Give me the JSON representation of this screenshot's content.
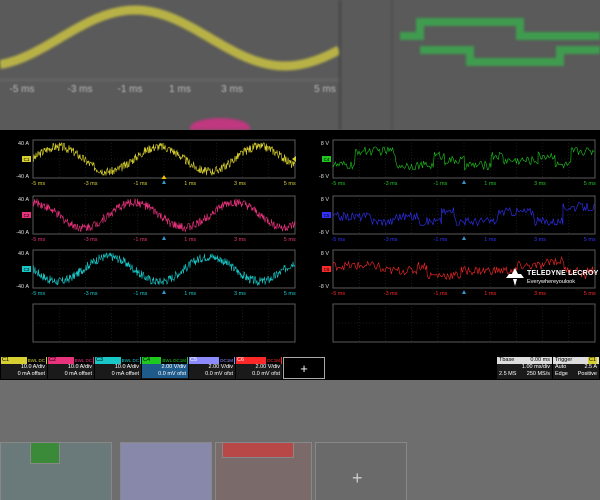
{
  "colors": {
    "c1": "#d8d030",
    "c2": "#e8327c",
    "c3": "#18c8c8",
    "c4": "#1ec81e",
    "c5": "#3232ff",
    "c6": "#ff2828"
  },
  "time_ticks": [
    "-5 ms",
    "-3 ms",
    "-1 ms",
    "1 ms",
    "3 ms",
    "5 ms"
  ],
  "bg_ticks": [
    "-5 ms",
    "-3 ms",
    "-1 ms",
    "1 ms",
    "3 ms",
    "5 ms"
  ],
  "ylabels": {
    "analog": {
      "top": "40 A",
      "bottom": "-40 A"
    },
    "digital": {
      "top": "8 V",
      "bottom": "-8 V"
    }
  },
  "logo": {
    "brand": "TELEDYNE LECROY",
    "tagline": "Everywhereyoulook"
  },
  "channels": [
    {
      "name": "C1",
      "badge": "BWL DC",
      "line1": "10.0 A/div",
      "line2": "0 mA offset",
      "color": "#d8d030"
    },
    {
      "name": "C2",
      "badge": "BWL DC",
      "line1": "10.0 A/div",
      "line2": "0 mA offset",
      "color": "#e8327c"
    },
    {
      "name": "C3",
      "badge": "BWL DC",
      "line1": "10.0 A/div",
      "line2": "0 mA offset",
      "color": "#18c8c8"
    },
    {
      "name": "C4",
      "badge": "BWL DC1M",
      "line1": "2.00 V/div",
      "line2": "0.0 mV ofst",
      "color": "#1ec81e"
    },
    {
      "name": "C5",
      "badge": "DC1M",
      "line1": "2.00 V/div",
      "line2": "0.0 mV ofst",
      "color": "#8c8cff"
    },
    {
      "name": "C6",
      "badge": "DC1M",
      "line1": "2.00 V/div",
      "line2": "0.0 mV ofst",
      "color": "#ff2828"
    }
  ],
  "add_label": "+",
  "timebase": {
    "label": "Tbase",
    "delay": "0.00 ms",
    "div": "1.00 ms/div",
    "samples": "2.5 MS",
    "rate": "250 MS/s"
  },
  "trigger": {
    "label": "Trigger",
    "channel": "C1",
    "level": "2.5 A",
    "mode": "Auto",
    "type": "Edge",
    "slope": "Positive"
  }
}
